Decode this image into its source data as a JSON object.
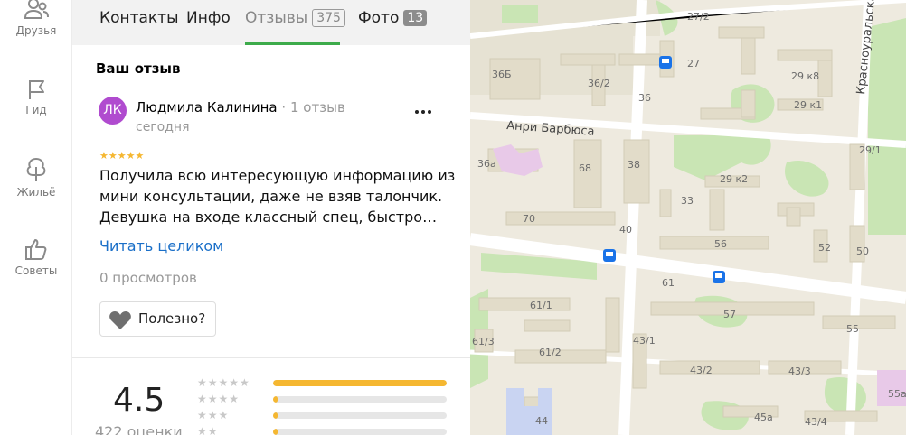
{
  "nav": {
    "items": [
      {
        "label": "Друзья",
        "icon": "people-icon"
      },
      {
        "label": "Гид",
        "icon": "flag-icon"
      },
      {
        "label": "Жильё",
        "icon": "tree-icon"
      },
      {
        "label": "Советы",
        "icon": "thumbs-up-icon"
      }
    ]
  },
  "tabs": {
    "contacts": "Контакты",
    "info": "Инфо",
    "reviews": "Отзывы",
    "reviews_count": "375",
    "photos": "Фото",
    "photos_count": "13",
    "active": "reviews"
  },
  "my_review": {
    "section_title": "Ваш отзыв",
    "avatar_initials": "ЛК",
    "avatar_color": "#b04bcf",
    "author": "Людмила Калинина",
    "author_reviews": "1 отзыв",
    "date": "сегодня",
    "more": "•••",
    "rating": 5,
    "text": "Получила всю интересующую информацию из мини консультации, даже не взяв талончик. Девушка на входе классный спец, быстро…",
    "read_more": "Читать целиком",
    "views": "0 просмотров",
    "useful": "Полезно?"
  },
  "rating_summary": {
    "value": "4.5",
    "count": "422 оценки",
    "histogram": [
      {
        "stars": 5,
        "fraction": 1.0
      },
      {
        "stars": 4,
        "fraction": 0.02
      },
      {
        "stars": 3,
        "fraction": 0.02
      },
      {
        "stars": 2,
        "fraction": 0.02
      }
    ]
  },
  "map": {
    "streets": [
      "Анри Барбюса",
      "Красноуральская"
    ],
    "house_numbers": [
      "27/2",
      "27",
      "36Б",
      "36/2",
      "36",
      "29 к8",
      "29 к1",
      "68",
      "38",
      "36а",
      "29 к2",
      "33",
      "29/1",
      "70",
      "40",
      "56",
      "52",
      "50",
      "61",
      "57",
      "55",
      "61/1",
      "43/1",
      "61/3",
      "61/2",
      "43/2",
      "43/3",
      "44",
      "45а",
      "43/4",
      "55а"
    ],
    "colors": {
      "background": "#eeeadf",
      "park": "#c9e5b4",
      "building": "#e2dcc9",
      "road": "#ffffff",
      "school": "#e8c9e8",
      "hospital": "#c9d4f2",
      "transit": "#1a73e8"
    }
  }
}
